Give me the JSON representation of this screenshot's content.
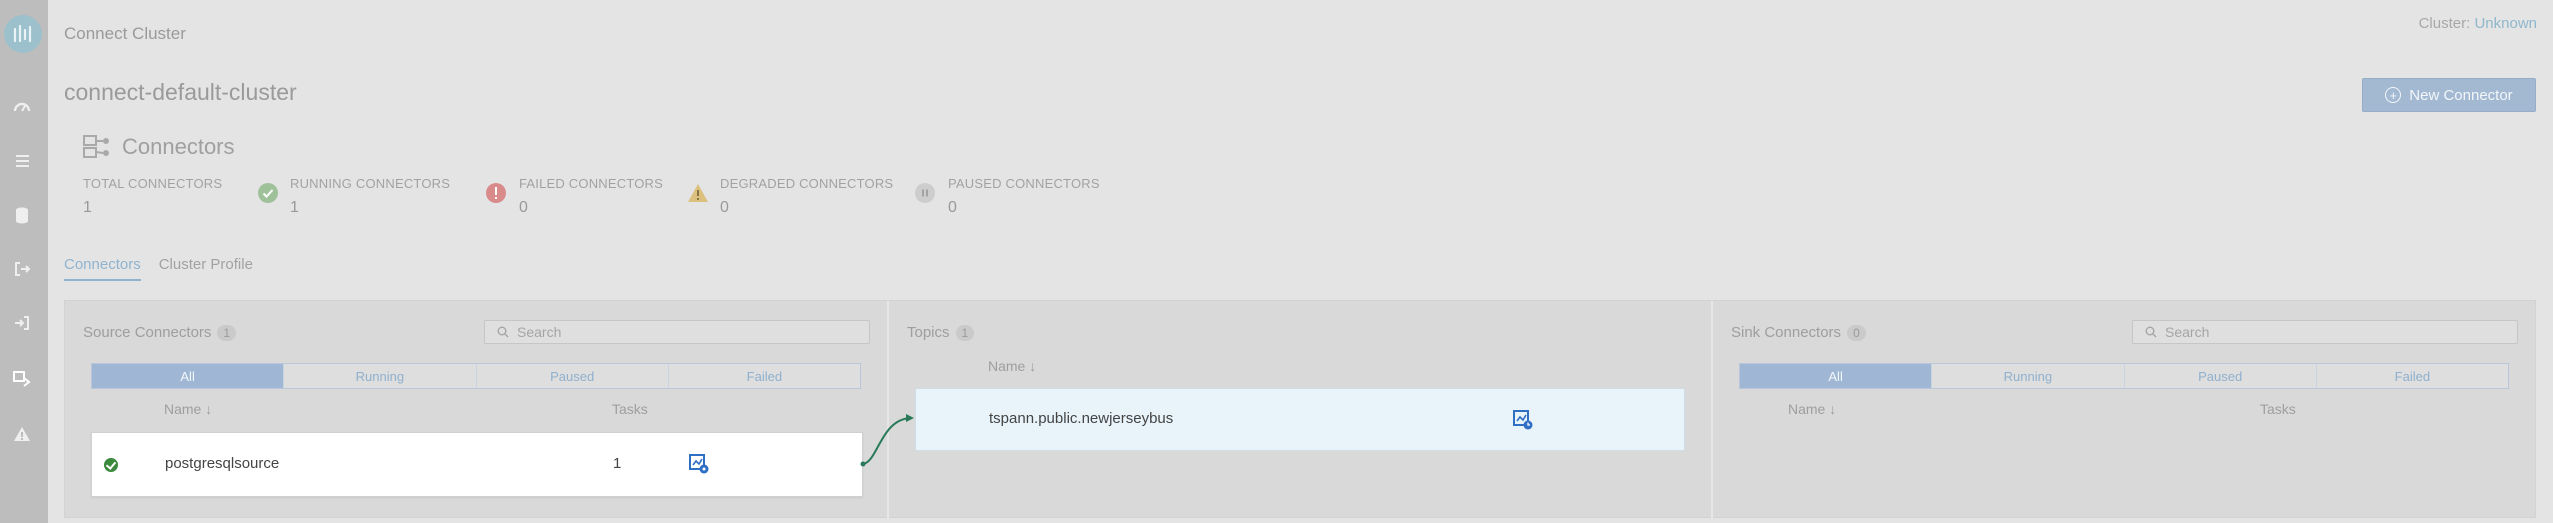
{
  "app": {
    "title": "Connect Cluster",
    "cluster_label": "Cluster:",
    "cluster_value": "Unknown",
    "cluster_name": "connect-default-cluster"
  },
  "actions": {
    "new_connector_label": "New Connector"
  },
  "connectors_section": {
    "title": "Connectors",
    "stats": [
      {
        "label": "TOTAL CONNECTORS",
        "value": "1",
        "icon": "none"
      },
      {
        "label": "RUNNING CONNECTORS",
        "value": "1",
        "icon": "check-circle-icon"
      },
      {
        "label": "FAILED CONNECTORS",
        "value": "0",
        "icon": "error-icon"
      },
      {
        "label": "DEGRADED CONNECTORS",
        "value": "0",
        "icon": "warning-icon"
      },
      {
        "label": "PAUSED CONNECTORS",
        "value": "0",
        "icon": "pause-icon"
      }
    ]
  },
  "tabs": [
    "Connectors",
    "Cluster Profile"
  ],
  "source": {
    "title": "Source Connectors",
    "count": "1",
    "search_placeholder": "Search",
    "filters": [
      "All",
      "Running",
      "Paused",
      "Failed"
    ],
    "col_name": "Name ↓",
    "col_tasks": "Tasks",
    "rows": [
      {
        "name": "postgresqlsource",
        "tasks": "1",
        "status": "running"
      }
    ]
  },
  "topics": {
    "title": "Topics",
    "count": "1",
    "col_name": "Name ↓",
    "rows": [
      {
        "name": "tspann.public.newjerseybus"
      }
    ]
  },
  "sink": {
    "title": "Sink Connectors",
    "count": "0",
    "search_placeholder": "Search",
    "filters": [
      "All",
      "Running",
      "Paused",
      "Failed"
    ],
    "col_name": "Name ↓",
    "col_tasks": "Tasks"
  },
  "colors": {
    "accent": "#8fb3cf",
    "running": "#3b8a3e",
    "failed": "#d97a7a",
    "degraded": "#d9b56a",
    "connector_line": "#2a7a5a"
  }
}
